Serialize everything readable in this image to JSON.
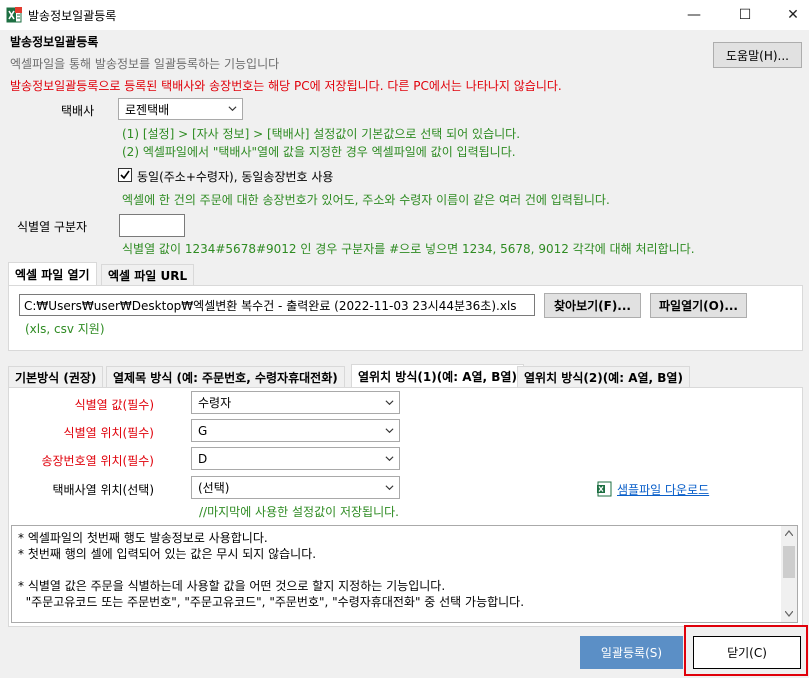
{
  "window": {
    "title": "발송정보일괄등록",
    "minimize_glyph": "—",
    "maximize_glyph": "☐",
    "close_glyph": "✕"
  },
  "header": {
    "heading": "발송정보일괄등록",
    "description": "엑셀파일을 통해 발송정보를 일괄등록하는 기능입니다",
    "warning": "발송정보일괄등록으로 등록된 택배사와 송장번호는 해당 PC에 저장됩니다. 다른 PC에서는 나타나지 않습니다.",
    "help_button": "도움말(H)..."
  },
  "courier": {
    "label": "택배사",
    "selected": "로젠택배",
    "hint1": "(1) [설정] > [자사 정보] > [택배사] 설정값이 기본값으로 선택 되어 있습니다.",
    "hint2": "(2) 엑셀파일에서 \"택배사\"열에 값을 지정한 경우 엑셀파일에 값이 입력됩니다."
  },
  "same_invoice": {
    "checked": true,
    "label": "동일(주소+수령자), 동일송장번호 사용",
    "hint": "엑셀에 한 건의 주문에 대한 송장번호가 있어도, 주소와 수령자 이름이 같은 여러 건에 입력됩니다."
  },
  "separator": {
    "label": "식별열 구분자",
    "value": "",
    "hint": "식별열 값이 1234#5678#9012 인 경우 구분자를 #으로 넣으면 1234, 5678, 9012 각각에 대해 처리합니다."
  },
  "file_tabs": [
    {
      "label": "엑셀 파일 열기",
      "active": true
    },
    {
      "label": "엑셀 파일 URL",
      "active": false
    }
  ],
  "file": {
    "path": "C:₩Users₩user₩Desktop₩엑셀변환 복수건 - 출력완료 (2022-11-03 23시44분36초).xls",
    "browse_button": "찾아보기(F)...",
    "open_button": "파일열기(O)...",
    "formats": "(xls, csv 지원)"
  },
  "method_tabs": [
    {
      "label": "기본방식 (권장)",
      "active": false
    },
    {
      "label": "열제목 방식 (예: 주문번호, 수령자휴대전화)",
      "active": false
    },
    {
      "label": "열위치 방식(1)(예: A열, B열)",
      "active": true
    },
    {
      "label": "열위치 방식(2)(예: A열, B열)",
      "active": false
    }
  ],
  "fields": [
    {
      "label": "식별열 값(필수)",
      "value": "수령자",
      "required": true
    },
    {
      "label": "식별열 위치(필수)",
      "value": "G",
      "required": true
    },
    {
      "label": "송장번호열 위치(필수)",
      "value": "D",
      "required": true
    },
    {
      "label": "택배사열 위치(선택)",
      "value": "(선택)",
      "required": false
    }
  ],
  "save_note": "//마지막에 사용한 설정값이 저장됩니다.",
  "sample_link": "샘플파일 다운로드",
  "notes": "* 엑셀파일의 첫번째 행도 발송정보로 사용합니다.\n* 첫번째 행의 셀에 입력되어 있는 값은 무시 되지 않습니다.\n\n* 식별열 값은 주문을 식별하는데 사용할 값을 어떤 것으로 할지 지정하는 기능입니다.\n  \"주문고유코드 또는 주문번호\", \"주문고유코드\", \"주문번호\", \"수령자휴대전화\" 중 선택 가능합니다.",
  "footer": {
    "register_button": "일괄등록(S)",
    "close_button": "닫기(C)"
  },
  "colors": {
    "warning_red": "#e0000a",
    "hint_green": "#2e8b22",
    "link_blue": "#0a5fc9",
    "primary_button": "#5b8fc6",
    "highlight_red": "#e0000a"
  },
  "icons": {
    "app": "excel-icon",
    "sample": "excel-icon",
    "dropdown": "chevron-down-icon"
  }
}
